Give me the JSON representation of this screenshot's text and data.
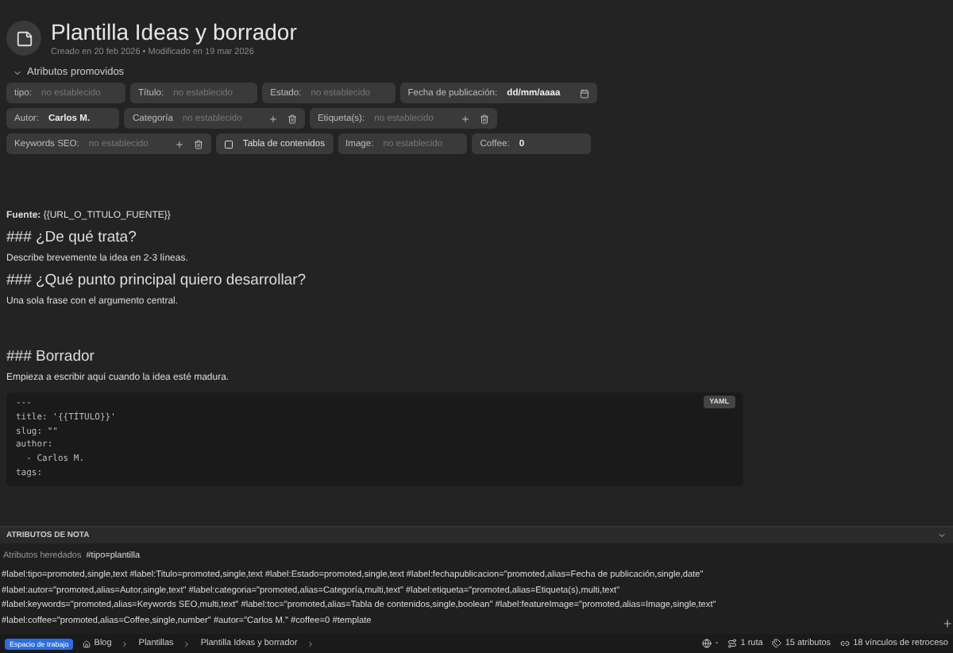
{
  "note": {
    "title": "Plantilla Ideas y borrador",
    "meta": "Creado en 20 feb 2026 • Modificado en 19 mar 2026"
  },
  "promoted": {
    "label": "Atributos promovidos",
    "expanded": true,
    "rows": [
      [
        {
          "kind": "text",
          "label": "tipo:",
          "placeholder": "no establecido"
        },
        {
          "kind": "text",
          "label": "Título:",
          "placeholder": "no establecido"
        },
        {
          "kind": "text",
          "label": "Estado:",
          "placeholder": "no establecido"
        },
        {
          "kind": "date",
          "label": "Fecha de publicación:",
          "value": "dd/mm/aaaa"
        }
      ],
      [
        {
          "kind": "text",
          "label": "Autor:",
          "value": "Carlos M."
        },
        {
          "kind": "multi",
          "label": "Categoría",
          "placeholder": "no establecido"
        },
        {
          "kind": "multi",
          "label": "Etiqueta(s):",
          "placeholder": "no establecido"
        }
      ],
      [
        {
          "kind": "multi",
          "label": "Keywords SEO:",
          "placeholder": "no establecido"
        },
        {
          "kind": "boolean",
          "label": "Tabla de contenidos",
          "checked": false
        },
        {
          "kind": "text",
          "label": "Image:",
          "placeholder": "no establecido"
        },
        {
          "kind": "number",
          "label": "Coffee:",
          "value": "0"
        }
      ]
    ]
  },
  "content": [
    {
      "kind": "para",
      "text": "**Fuente:** {{URL_O_TITULO_FUENTE}}"
    },
    {
      "kind": "heading",
      "text": "### ¿De qué trata?"
    },
    {
      "kind": "para",
      "text": "Describe brevemente la idea en 2-3 líneas."
    },
    {
      "kind": "heading",
      "text": "### ¿Qué punto principal quiero desarrollar?"
    },
    {
      "kind": "para",
      "text": "Una sola frase con el argumento central."
    },
    {
      "kind": "spacer"
    },
    {
      "kind": "heading",
      "text": "### Borrador"
    },
    {
      "kind": "para",
      "text": "Empieza a escribir aquí cuando la idea esté madura."
    }
  ],
  "code_block": {
    "language": "YAML",
    "lines": [
      "---",
      "title: '{{TÍTULO}}'",
      "slug: \"\"",
      "author:",
      "  - Carlos M.",
      "tags:"
    ]
  },
  "attributes_panel": {
    "title": "ATRIBUTOS DE NOTA",
    "inherited_label": "Atributos heredados",
    "inherited_value": "#tipo=plantilla",
    "lines": [
      "#label:tipo=promoted,single,text #label:Titulo=promoted,single,text #label:Estado=promoted,single,text #label:fechapublicacion=\"promoted,alias=Fecha de publicación,single,date\"",
      "#label:autor=\"promoted,alias=Autor,single,text\" #label:categoria=\"promoted,alias=Categoría,multi,text\" #label:etiqueta=\"promoted,alias=Etiqueta(s),multi,text\"",
      "#label:keywords=\"promoted,alias=Keywords SEO,multi,text\" #label:toc=\"promoted,alias=Tabla de contenidos,single,boolean\" #label:featureImage=\"promoted,alias=Image,single,text\"",
      "#label:coffee=\"promoted,alias=Coffee,single,number\" #autor=\"Carlos M.\" #coffee=0 #template"
    ]
  },
  "status_bar": {
    "workspace": "Espacio de trabajo",
    "breadcrumbs": [
      "Blog",
      "Plantillas",
      "Plantilla Ideas y borrador"
    ],
    "language": "-",
    "paths": "1 ruta",
    "attributes": "15 atributos",
    "backlinks": "18 vínculos de retroceso"
  }
}
